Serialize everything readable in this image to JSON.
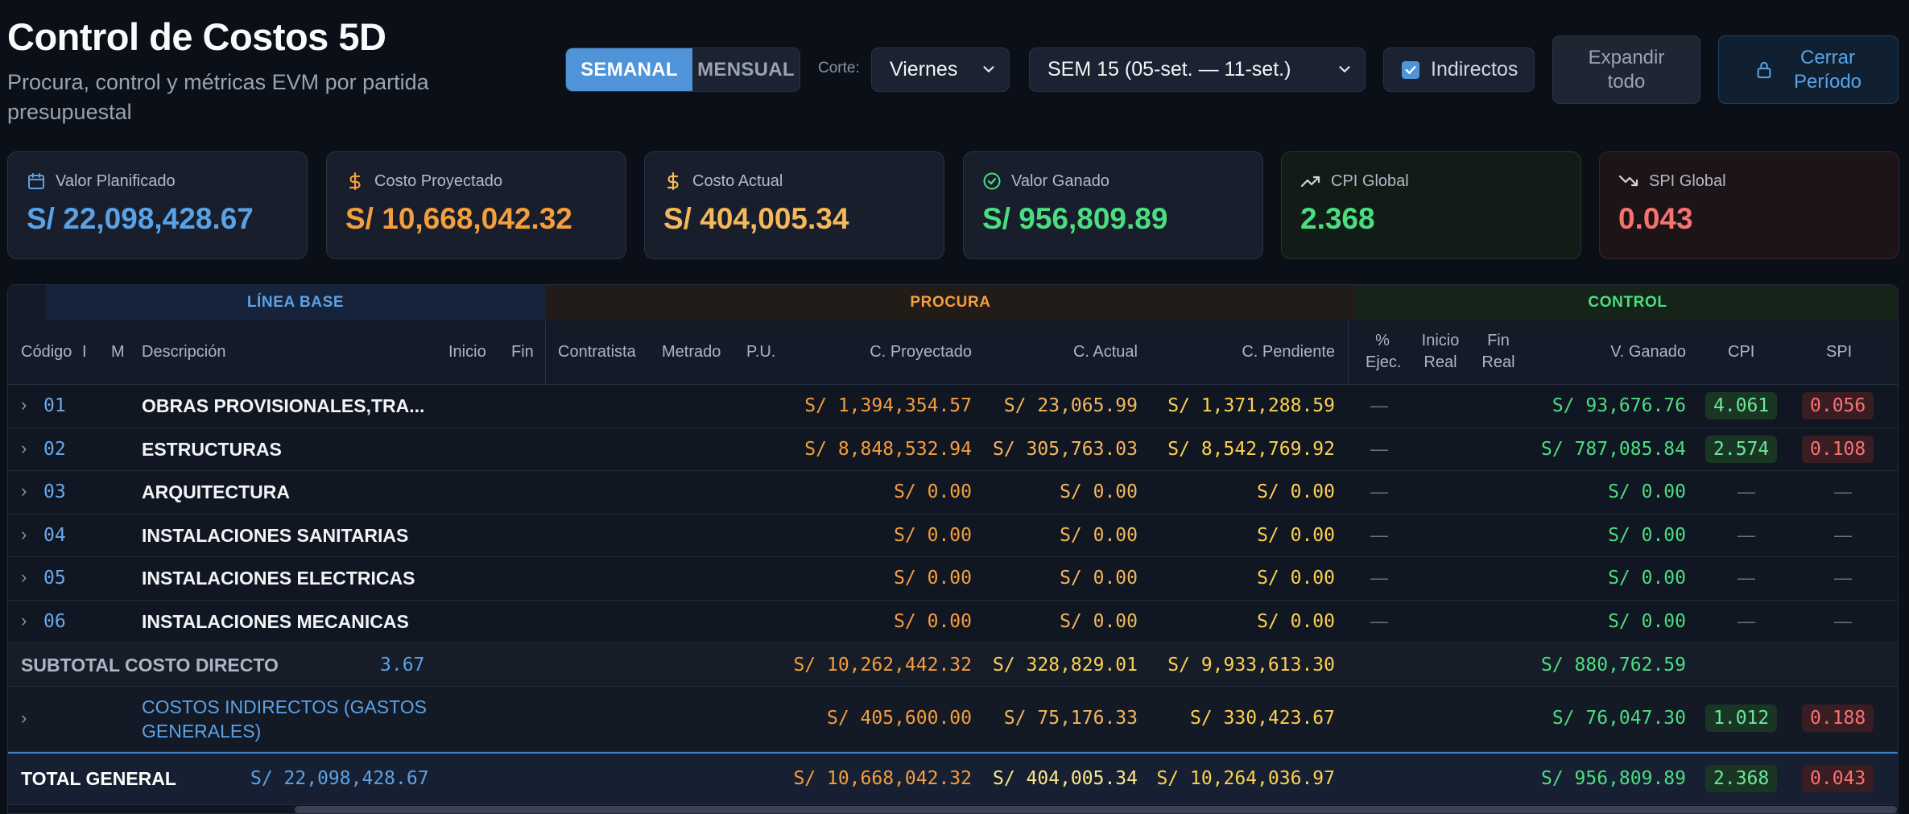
{
  "header": {
    "title": "Control de Costos 5D",
    "subtitle": "Procura, control y métricas EVM por partida presupuestal"
  },
  "toolbar": {
    "period_tabs": [
      "SEMANAL",
      "MENSUAL"
    ],
    "active_tab": "SEMANAL",
    "corte_label": "Corte:",
    "corte_value": "Viernes",
    "week_value": "SEM 15 (05-set. — 11-set.)",
    "indirect_label": "Indirectos",
    "indirect_checked": true,
    "expand_label_1": "Expandir",
    "expand_label_2": "todo",
    "close_label_1": "Cerrar",
    "close_label_2": "Período"
  },
  "kpis": [
    {
      "label": "Valor Planificado",
      "value": "S/ 22,098,428.67",
      "icon": "calendar-icon",
      "color": "#5aa2e6"
    },
    {
      "label": "Costo Proyectado",
      "value": "S/ 10,668,042.32",
      "icon": "dollar-icon",
      "color": "#f59e3c"
    },
    {
      "label": "Costo Actual",
      "value": "S/ 404,005.34",
      "icon": "dollar-icon",
      "color": "#f4b85a"
    },
    {
      "label": "Valor Ganado",
      "value": "S/ 956,809.89",
      "icon": "check-circle-icon",
      "color": "#4ade80"
    },
    {
      "label": "CPI Global",
      "value": "2.368",
      "icon": "trend-up-icon",
      "color": "#4ade80"
    },
    {
      "label": "SPI Global",
      "value": "0.043",
      "icon": "trend-down-icon",
      "color": "#f87171"
    }
  ],
  "table": {
    "groups": {
      "linea_base": "LÍNEA BASE",
      "procura": "PROCURA",
      "control": "CONTROL"
    },
    "columns": {
      "codigo": "Código",
      "c2": "I",
      "c3": "M",
      "descripcion": "Descripción",
      "inicio": "Inicio",
      "fin": "Fin",
      "contratista": "Contratista",
      "metrado": "Metrado",
      "pu": "P.U.",
      "c_proyectado": "C. Proyectado",
      "c_actual": "C. Actual",
      "c_pendiente": "C. Pendiente",
      "pct_1": "%",
      "pct_2": "Ejec.",
      "inicio_real_1": "Inicio",
      "inicio_real_2": "Real",
      "fin_real_1": "Fin",
      "fin_real_2": "Real",
      "v_ganado": "V. Ganado",
      "cpi": "CPI",
      "spi": "SPI"
    },
    "rows": [
      {
        "code": "01",
        "desc": "OBRAS PROVISIONALES,TRA...",
        "proy": "S/ 1,394,354.57",
        "act": "S/ 23,065.99",
        "pend": "S/ 1,371,288.59",
        "pct": "—",
        "vg": "S/ 93,676.76",
        "cpi": "4.061",
        "spi": "0.056"
      },
      {
        "code": "02",
        "desc": "ESTRUCTURAS",
        "proy": "S/ 8,848,532.94",
        "act": "S/ 305,763.03",
        "pend": "S/ 8,542,769.92",
        "pct": "—",
        "vg": "S/ 787,085.84",
        "cpi": "2.574",
        "spi": "0.108"
      },
      {
        "code": "03",
        "desc": "ARQUITECTURA",
        "proy": "S/ 0.00",
        "act": "S/ 0.00",
        "pend": "S/ 0.00",
        "pct": "—",
        "vg": "S/ 0.00",
        "cpi": "—",
        "spi": "—"
      },
      {
        "code": "04",
        "desc": "INSTALACIONES SANITARIAS",
        "proy": "S/ 0.00",
        "act": "S/ 0.00",
        "pend": "S/ 0.00",
        "pct": "—",
        "vg": "S/ 0.00",
        "cpi": "—",
        "spi": "—"
      },
      {
        "code": "05",
        "desc": "INSTALACIONES ELECTRICAS",
        "proy": "S/ 0.00",
        "act": "S/ 0.00",
        "pend": "S/ 0.00",
        "pct": "—",
        "vg": "S/ 0.00",
        "cpi": "—",
        "spi": "—"
      },
      {
        "code": "06",
        "desc": "INSTALACIONES MECANICAS",
        "proy": "S/ 0.00",
        "act": "S/ 0.00",
        "pend": "S/ 0.00",
        "pct": "—",
        "vg": "S/ 0.00",
        "cpi": "—",
        "spi": "—"
      }
    ],
    "subtotal": {
      "label": "SUBTOTAL COSTO DIRECTO",
      "base": "3.67",
      "proy": "S/ 10,262,442.32",
      "act": "S/ 328,829.01",
      "pend": "S/ 9,933,613.30",
      "vg": "S/ 880,762.59"
    },
    "indirect": {
      "label_1": "COSTOS INDIRECTOS (GASTOS",
      "label_2": "GENERALES)",
      "proy": "S/ 405,600.00",
      "act": "S/ 75,176.33",
      "pend": "S/ 330,423.67",
      "vg": "S/ 76,047.30",
      "cpi": "1.012",
      "spi": "0.188"
    },
    "total": {
      "label": "TOTAL GENERAL",
      "base": "S/ 22,098,428.67",
      "proy": "S/ 10,668,042.32",
      "act": "S/ 404,005.34",
      "pend": "S/ 10,264,036.97",
      "vg": "S/ 956,809.89",
      "cpi": "2.368",
      "spi": "0.043"
    }
  }
}
